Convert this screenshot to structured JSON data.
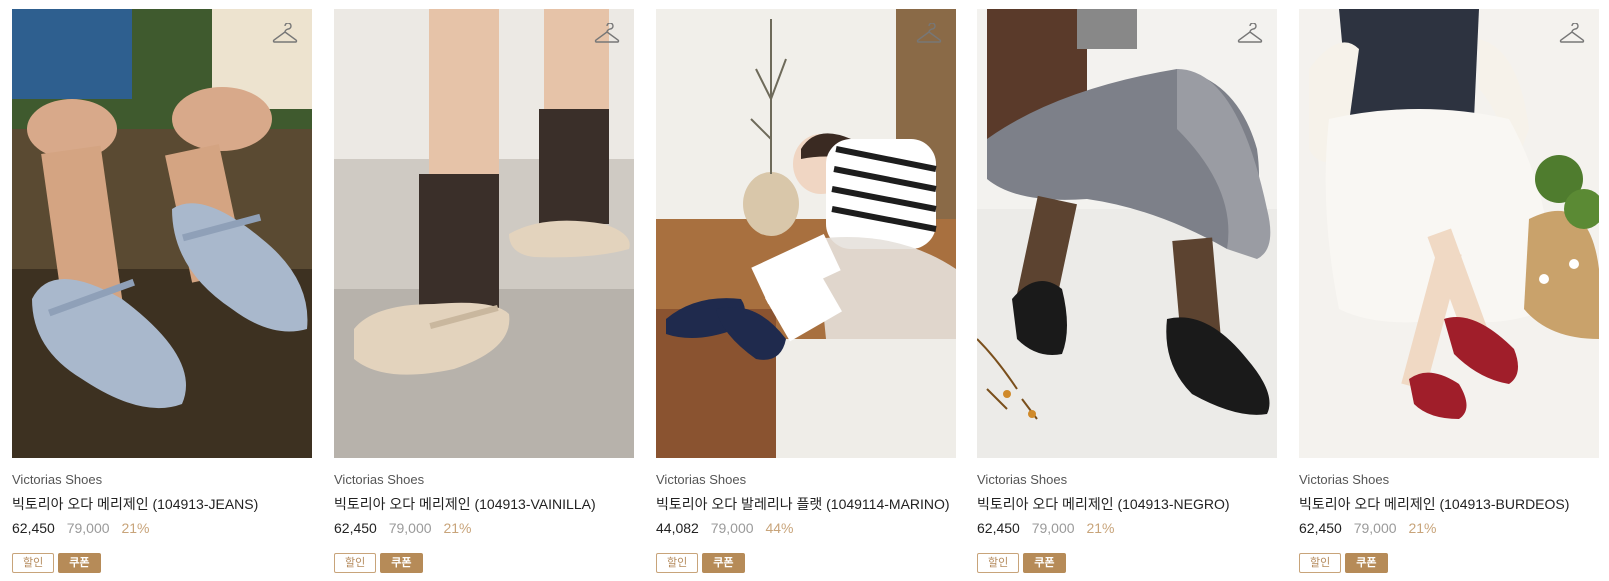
{
  "products": [
    {
      "brand": "Victorias Shoes",
      "title": "빅토리아 오다 메리제인 (104913-JEANS)",
      "price": "62,450",
      "original_price": "79,000",
      "discount": "21%",
      "tags": [
        "할인",
        "쿠폰"
      ],
      "icon": "hanger-icon",
      "shoe_color": "#a9b8cc"
    },
    {
      "brand": "Victorias Shoes",
      "title": "빅토리아 오다 메리제인 (104913-VAINILLA)",
      "price": "62,450",
      "original_price": "79,000",
      "discount": "21%",
      "tags": [
        "할인",
        "쿠폰"
      ],
      "icon": "hanger-icon",
      "shoe_color": "#e3d3bd"
    },
    {
      "brand": "Victorias Shoes",
      "title": "빅토리아 오다 발레리나 플랫 (1049114-MARINO)",
      "price": "44,082",
      "original_price": "79,000",
      "discount": "44%",
      "tags": [
        "할인",
        "쿠폰"
      ],
      "icon": "hanger-icon",
      "shoe_color": "#1f2a4d"
    },
    {
      "brand": "Victorias Shoes",
      "title": "빅토리아 오다 메리제인 (104913-NEGRO)",
      "price": "62,450",
      "original_price": "79,000",
      "discount": "21%",
      "tags": [
        "할인",
        "쿠폰"
      ],
      "icon": "hanger-icon",
      "shoe_color": "#1a1a1a"
    },
    {
      "brand": "Victorias Shoes",
      "title": "빅토리아 오다 메리제인 (104913-BURDEOS)",
      "price": "62,450",
      "original_price": "79,000",
      "discount": "21%",
      "tags": [
        "할인",
        "쿠폰"
      ],
      "icon": "hanger-icon",
      "shoe_color": "#a01e2a"
    }
  ],
  "colors": {
    "accent": "#b68b58",
    "discount_text": "#c8a47a",
    "muted_price": "#9a9a9a"
  }
}
